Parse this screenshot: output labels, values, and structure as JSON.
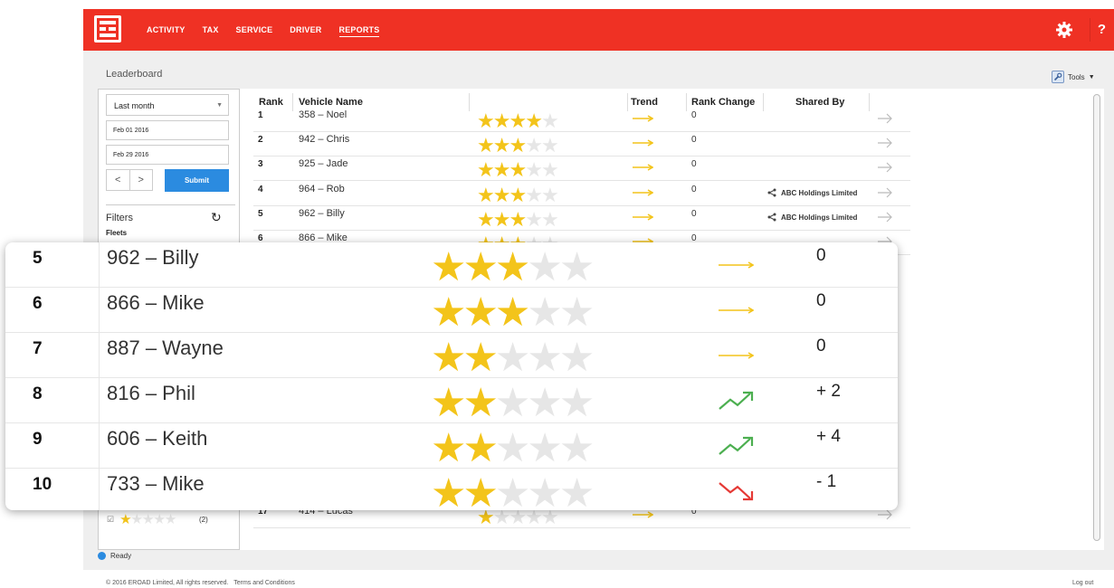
{
  "nav": {
    "items": [
      "ACTIVITY",
      "TAX",
      "SERVICE",
      "DRIVER",
      "REPORTS"
    ],
    "active": "REPORTS",
    "help_label": "?"
  },
  "page": {
    "title": "Leaderboard",
    "tools_label": "Tools"
  },
  "sidebar": {
    "period": "Last month",
    "start_date": "Feb 01 2016",
    "end_date": "Feb 29 2016",
    "prev_label": "<",
    "next_label": ">",
    "submit_label": "Submit",
    "filters_label": "Filters",
    "fleets_label": "Fleets",
    "filter_star_rating": 1,
    "filter_count": "(2)"
  },
  "table": {
    "headers": {
      "rank": "Rank",
      "vehicle": "Vehicle Name",
      "trend": "Trend",
      "rank_change": "Rank Change",
      "shared_by": "Shared By"
    },
    "rows": [
      {
        "rank": "1",
        "vehicle": "358 – Noel",
        "stars": 4,
        "trend": "flat",
        "change": "0",
        "shared": ""
      },
      {
        "rank": "2",
        "vehicle": "942 – Chris",
        "stars": 3,
        "trend": "flat",
        "change": "0",
        "shared": ""
      },
      {
        "rank": "3",
        "vehicle": "925 – Jade",
        "stars": 3,
        "trend": "flat",
        "change": "0",
        "shared": ""
      },
      {
        "rank": "4",
        "vehicle": "964 – Rob",
        "stars": 3,
        "trend": "flat",
        "change": "0",
        "shared": "ABC Holdings Limited"
      },
      {
        "rank": "5",
        "vehicle": "962 – Billy",
        "stars": 3,
        "trend": "flat",
        "change": "0",
        "shared": "ABC Holdings Limited"
      },
      {
        "rank": "6",
        "vehicle": "866 – Mike",
        "stars": 3,
        "trend": "flat",
        "change": "0",
        "shared": ""
      },
      {
        "rank": "17",
        "vehicle": "414 – Lucas",
        "stars": 1,
        "trend": "flat",
        "change": "0",
        "shared": ""
      }
    ]
  },
  "zoom": {
    "rows": [
      {
        "rank": "5",
        "vehicle": "962 – Billy",
        "stars": 3,
        "trend": "flat",
        "change": "0"
      },
      {
        "rank": "6",
        "vehicle": "866 – Mike",
        "stars": 3,
        "trend": "flat",
        "change": "0"
      },
      {
        "rank": "7",
        "vehicle": "887 – Wayne",
        "stars": 2,
        "trend": "flat",
        "change": "0"
      },
      {
        "rank": "8",
        "vehicle": "816 – Phil",
        "stars": 2,
        "trend": "up",
        "change": "+ 2"
      },
      {
        "rank": "9",
        "vehicle": "606 – Keith",
        "stars": 2,
        "trend": "up",
        "change": "+ 4"
      },
      {
        "rank": "10",
        "vehicle": "733 – Mike",
        "stars": 2,
        "trend": "down",
        "change": "- 1"
      }
    ]
  },
  "status": {
    "label": "Ready"
  },
  "footer": {
    "copyright": "© 2016 EROAD Limited, All rights reserved.",
    "terms": "Terms and Conditions",
    "logout": "Log out"
  },
  "colors": {
    "brand_red": "#ef3124",
    "star_gold": "#f3c41a",
    "trend_flat": "#f3c41a",
    "trend_up": "#4caf50",
    "trend_down": "#e53935",
    "submit_blue": "#2b8be0"
  },
  "icons": {
    "logo": "eroad-logo-icon",
    "settings": "gear-icon",
    "help": "help-icon",
    "tools": "wrench-icon",
    "reset": "reset-icon",
    "share": "share-icon",
    "row_nav": "arrow-right-icon",
    "status": "status-dot-icon"
  }
}
